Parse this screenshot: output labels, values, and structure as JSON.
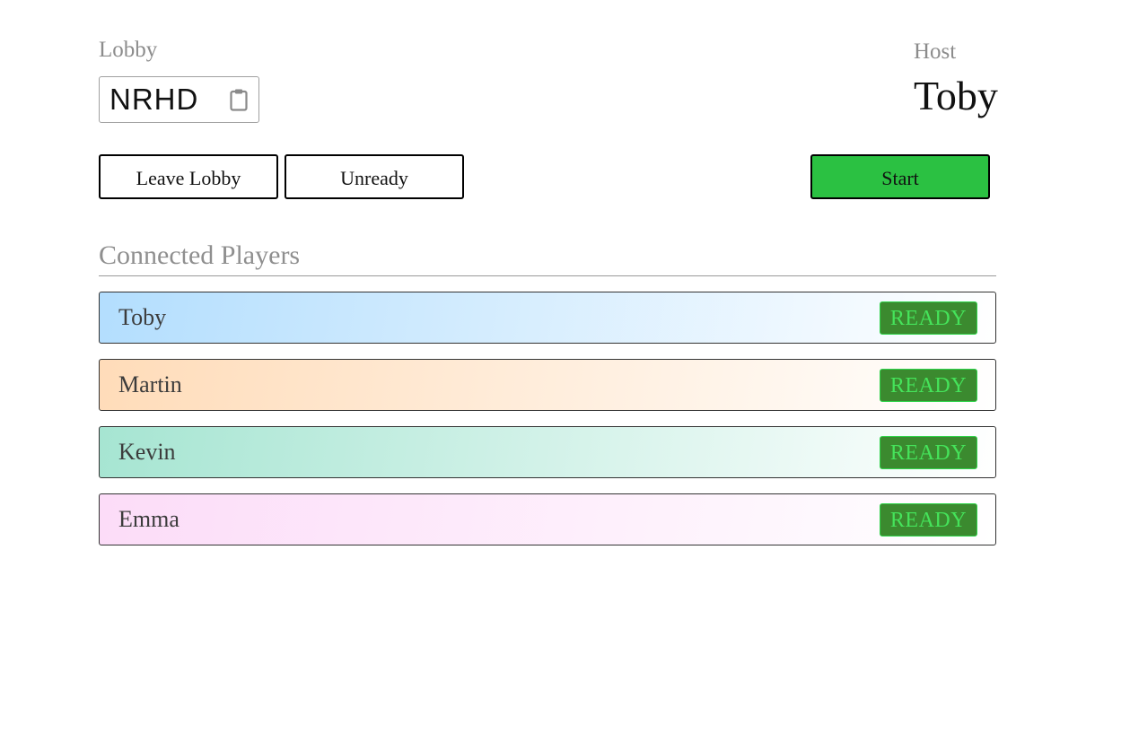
{
  "lobby": {
    "label": "Lobby",
    "code": "NRHD",
    "copy_icon": "clipboard-icon"
  },
  "host": {
    "label": "Host",
    "name": "Toby"
  },
  "actions": {
    "leave_label": "Leave Lobby",
    "unready_label": "Unready",
    "start_label": "Start"
  },
  "players_section": {
    "title": "Connected Players"
  },
  "players": [
    {
      "name": "Toby",
      "status": "READY",
      "color": "#b3defe"
    },
    {
      "name": "Martin",
      "status": "READY",
      "color": "#ffdcb9"
    },
    {
      "name": "Kevin",
      "status": "READY",
      "color": "#a6e5d2"
    },
    {
      "name": "Emma",
      "status": "READY",
      "color": "#fcdcf8"
    }
  ],
  "colors": {
    "start_button": "#2bc142",
    "ready_badge_bg": "#3b8a2f",
    "ready_badge_text": "#45e35a"
  }
}
